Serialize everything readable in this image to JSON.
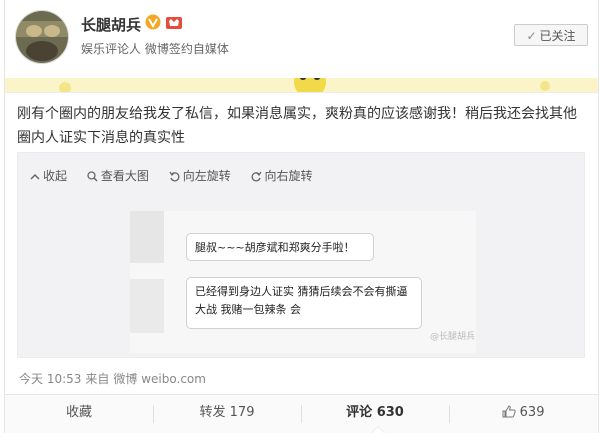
{
  "header": {
    "name": "长腿胡兵",
    "subtitle": "娱乐评论人 微博签约自媒体",
    "follow_button": "已关注"
  },
  "post": {
    "text": "刚有个圈内的朋友给我发了私信，如果消息属实，爽粉真的应该感谢我！稍后我还会找其他圈内人证实下消息的真实性"
  },
  "media": {
    "toolbar": [
      "收起",
      "查看大图",
      "向左旋转",
      "向右旋转"
    ],
    "bubble1": "腿叔~~~胡彦斌和郑爽分手啦！",
    "bubble2": "已经得到身边人证实 猜猜后续会不会有撕逼大战 我赌一包辣条 会"
  },
  "meta": {
    "time": "今天 10:53",
    "from_label": "来自",
    "source": "微博 weibo.com"
  },
  "actions": {
    "collect": "收藏",
    "repost_label": "转发",
    "repost_count": "179",
    "comment_label": "评论",
    "comment_count": "630",
    "like_count": "639"
  },
  "icons": {
    "verified": "verified-v-icon",
    "member": "member-crown-icon",
    "check": "check-icon",
    "collapse": "collapse-up-icon",
    "zoom": "magnifier-icon",
    "rotate_left": "rotate-left-icon",
    "rotate_right": "rotate-right-icon",
    "like": "thumbs-up-icon"
  },
  "colors": {
    "verified_orange": "#f5a623",
    "member_red": "#e44c3b",
    "strip_yellow": "#fbf4c8"
  }
}
